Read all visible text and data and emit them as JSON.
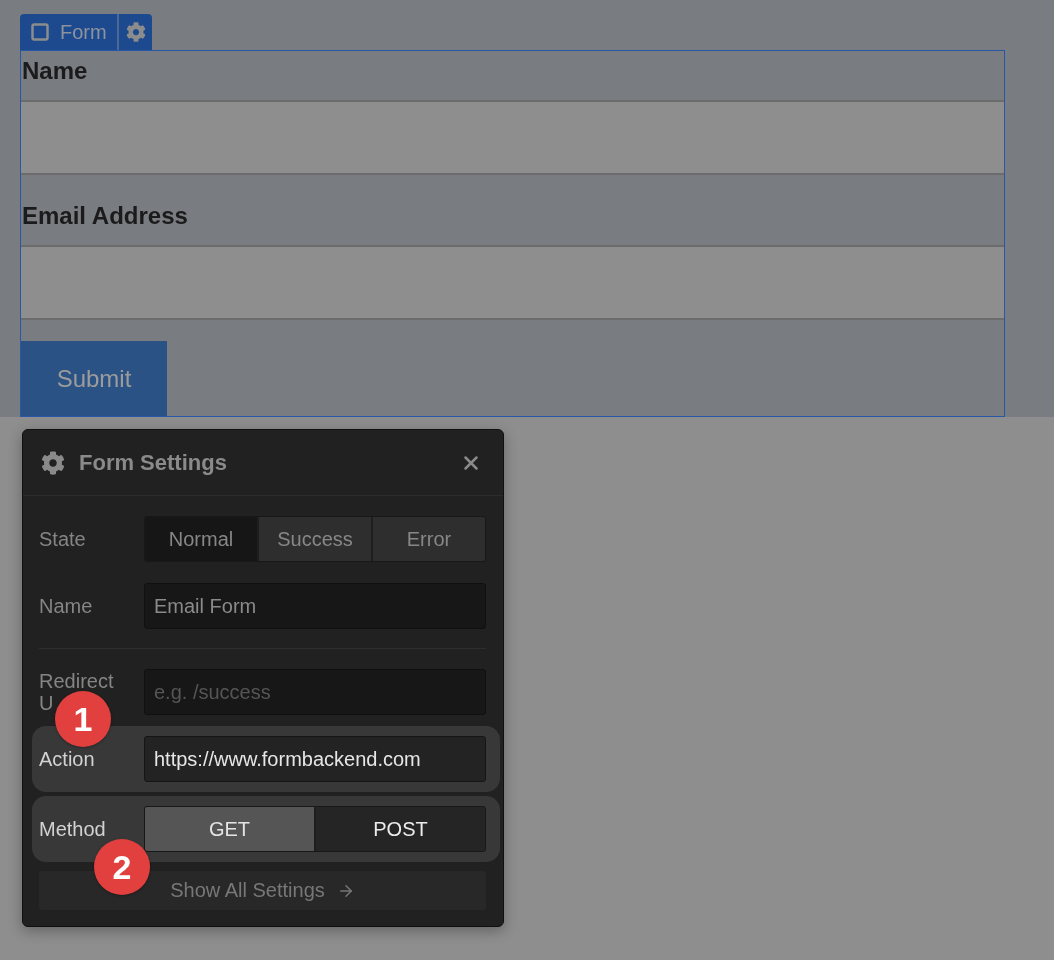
{
  "element_tag": {
    "label": "Form"
  },
  "form": {
    "fields": [
      {
        "label": "Name"
      },
      {
        "label": "Email Address"
      }
    ],
    "submit_button": "Submit"
  },
  "settings_panel": {
    "title": "Form Settings",
    "rows": [
      {
        "kind": "tabs",
        "label_lines": [
          "State"
        ],
        "highlighted": false,
        "divider_above": false,
        "options": [
          {
            "label": "Normal",
            "selected": true
          },
          {
            "label": "Success",
            "selected": false
          },
          {
            "label": "Error",
            "selected": false
          }
        ]
      },
      {
        "kind": "input",
        "label_lines": [
          "Name"
        ],
        "highlighted": false,
        "divider_above": false,
        "value": "Email Form"
      },
      {
        "kind": "input",
        "label_lines": [
          "Redirect",
          "U"
        ],
        "highlighted": false,
        "divider_above": true,
        "placeholder": "e.g. /success"
      },
      {
        "kind": "input",
        "label_lines": [
          "Action"
        ],
        "highlighted": true,
        "divider_above": false,
        "value": "https://www.formbackend.com"
      },
      {
        "kind": "toggle",
        "label_lines": [
          "Method"
        ],
        "highlighted": true,
        "divider_above": false,
        "options": [
          {
            "label": "GET",
            "selected": true
          },
          {
            "label": "POST",
            "selected": false
          }
        ]
      }
    ],
    "footer_button": "Show All Settings"
  },
  "callouts": [
    {
      "label": "1"
    },
    {
      "label": "2"
    }
  ]
}
